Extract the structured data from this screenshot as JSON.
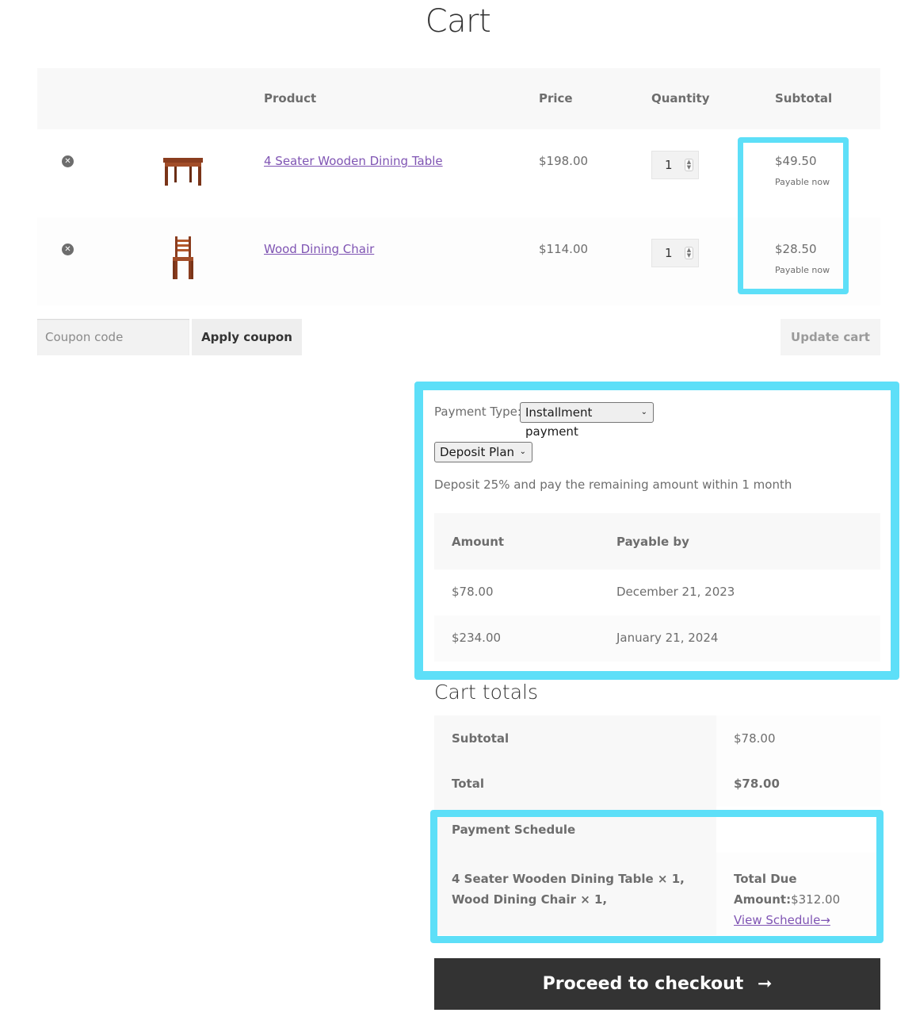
{
  "page": {
    "title": "Cart"
  },
  "cart_table": {
    "headers": {
      "product": "Product",
      "price": "Price",
      "quantity": "Quantity",
      "subtotal": "Subtotal"
    },
    "rows": [
      {
        "name": "4 Seater Wooden Dining Table",
        "price": "$198.00",
        "quantity": "1",
        "subtotal": "$49.50",
        "subtotal_note": "Payable now"
      },
      {
        "name": "Wood Dining Chair",
        "price": "$114.00",
        "quantity": "1",
        "subtotal": "$28.50",
        "subtotal_note": "Payable now"
      }
    ]
  },
  "coupon": {
    "placeholder": "Coupon code",
    "apply_label": "Apply coupon",
    "update_label": "Update cart"
  },
  "payment": {
    "type_label": "Payment Type:",
    "type_selected": "Installment payment",
    "plan_selected": "Deposit Plan",
    "plan_description": "Deposit 25% and pay the remaining amount within 1 month",
    "schedule_headers": {
      "amount": "Amount",
      "payable_by": "Payable by"
    },
    "schedule": [
      {
        "amount": "$78.00",
        "date": "December 21, 2023"
      },
      {
        "amount": "$234.00",
        "date": "January 21, 2024"
      }
    ]
  },
  "totals": {
    "title": "Cart totals",
    "subtotal_label": "Subtotal",
    "subtotal_value": "$78.00",
    "total_label": "Total",
    "total_value": "$78.00",
    "schedule_label": "Payment Schedule",
    "items_summary": "4 Seater Wooden Dining Table × 1, Wood Dining Chair × 1,",
    "total_due_label": "Total Due Amount:",
    "total_due_value": "$312.00",
    "view_schedule_label": "View Schedule→"
  },
  "checkout": {
    "label": "Proceed to checkout",
    "arrow": "➞"
  },
  "colors": {
    "highlight": "#5ddff8",
    "link": "#7f54b3",
    "checkout_bg": "#333333"
  }
}
